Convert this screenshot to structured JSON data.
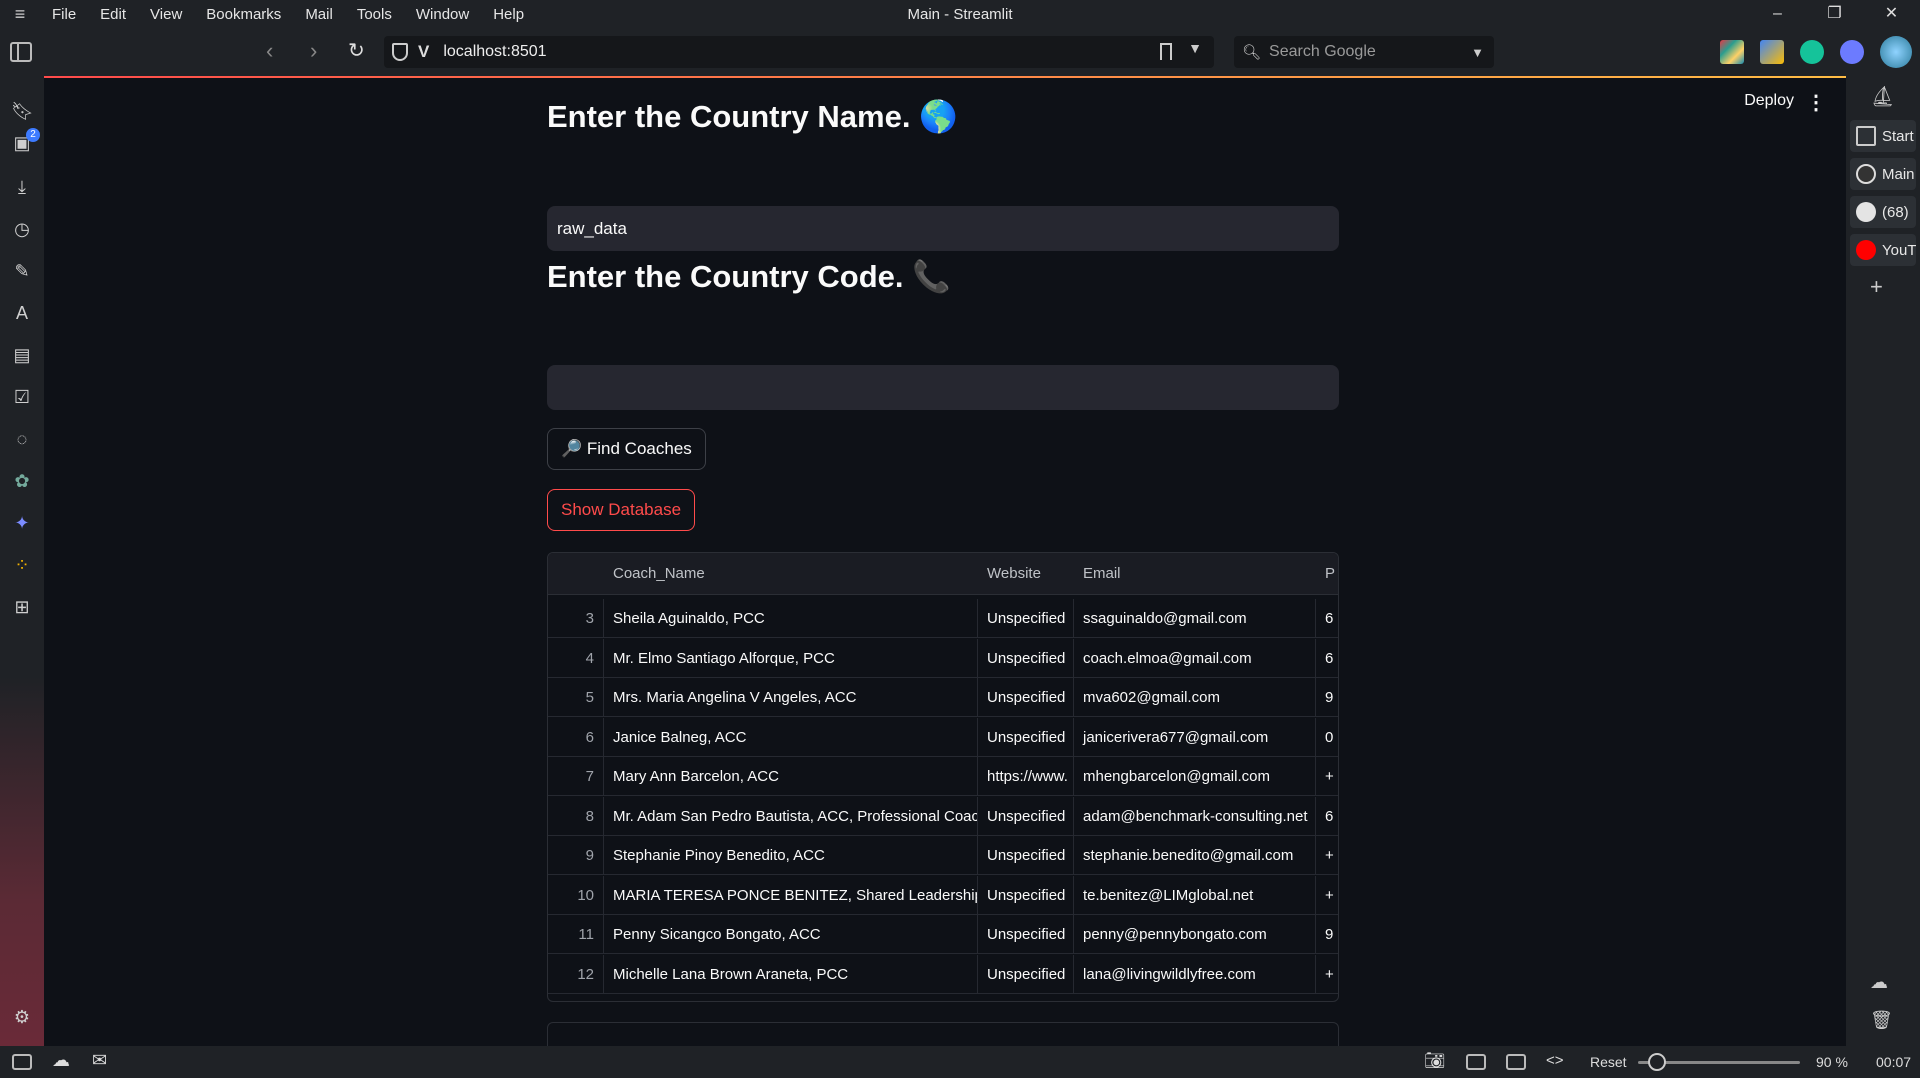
{
  "menubar": {
    "items": [
      "File",
      "Edit",
      "View",
      "Bookmarks",
      "Mail",
      "Tools",
      "Window",
      "Help"
    ],
    "window_title": "Main - Streamlit"
  },
  "address": {
    "url": "localhost:8501",
    "search_placeholder": "Search Google"
  },
  "left_panel": {
    "badge_count": "2"
  },
  "right_panel": {
    "items": [
      {
        "label": "Start",
        "icon": "grid-icon"
      },
      {
        "label": "Main",
        "icon": "streamlit-icon"
      },
      {
        "label": "(68)",
        "icon": "notification-icon"
      },
      {
        "label": "YouT",
        "icon": "youtube-icon"
      }
    ]
  },
  "header": {
    "deploy": "Deploy",
    "menu": "⋮"
  },
  "form": {
    "country_title": "Enter the Country Name. 🌎",
    "country_value": "raw_data",
    "code_title": "Enter the Country Code. 📞",
    "code_value": "",
    "find_button": "🔎 Find Coaches",
    "show_button": "Show Database"
  },
  "table": {
    "columns": [
      "",
      "Coach_Name",
      "Website",
      "Email",
      "P"
    ],
    "rows": [
      {
        "idx": "3",
        "name": "Sheila Aguinaldo, PCC",
        "website": "Unspecified",
        "email": "ssaguinaldo@gmail.com",
        "p": "6"
      },
      {
        "idx": "4",
        "name": "Mr. Elmo Santiago Alforque, PCC",
        "website": "Unspecified",
        "email": "coach.elmoa@gmail.com",
        "p": "6"
      },
      {
        "idx": "5",
        "name": "Mrs. Maria Angelina V Angeles, ACC",
        "website": "Unspecified",
        "email": "mva602@gmail.com",
        "p": "9"
      },
      {
        "idx": "6",
        "name": "Janice Balneg, ACC",
        "website": "Unspecified",
        "email": "janicerivera677@gmail.com",
        "p": "0"
      },
      {
        "idx": "7",
        "name": "Mary Ann Barcelon, ACC",
        "website": "https://www.",
        "email": "mhengbarcelon@gmail.com",
        "p": "+"
      },
      {
        "idx": "8",
        "name": "Mr. Adam San Pedro Bautista, ACC, Professional Coach",
        "website": "Unspecified",
        "email": "adam@benchmark-consulting.net",
        "p": "6"
      },
      {
        "idx": "9",
        "name": "Stephanie Pinoy Benedito, ACC",
        "website": "Unspecified",
        "email": "stephanie.benedito@gmail.com",
        "p": "+"
      },
      {
        "idx": "10",
        "name": "MARIA TERESA PONCE BENITEZ, Shared Leadership Tea",
        "website": "Unspecified",
        "email": "te.benitez@LIMglobal.net",
        "p": "+"
      },
      {
        "idx": "11",
        "name": "Penny Sicangco Bongato, ACC",
        "website": "Unspecified",
        "email": "penny@pennybongato.com",
        "p": "9"
      },
      {
        "idx": "12",
        "name": "Michelle Lana Brown Araneta, PCC",
        "website": "Unspecified",
        "email": "lana@livingwildlyfree.com",
        "p": "+"
      }
    ]
  },
  "statusbar": {
    "reset": "Reset",
    "zoom": "90 %",
    "time": "00:07"
  },
  "colors": {
    "accent": "#ff4b4b",
    "background": "#0e1117",
    "input_bg": "#262730"
  }
}
